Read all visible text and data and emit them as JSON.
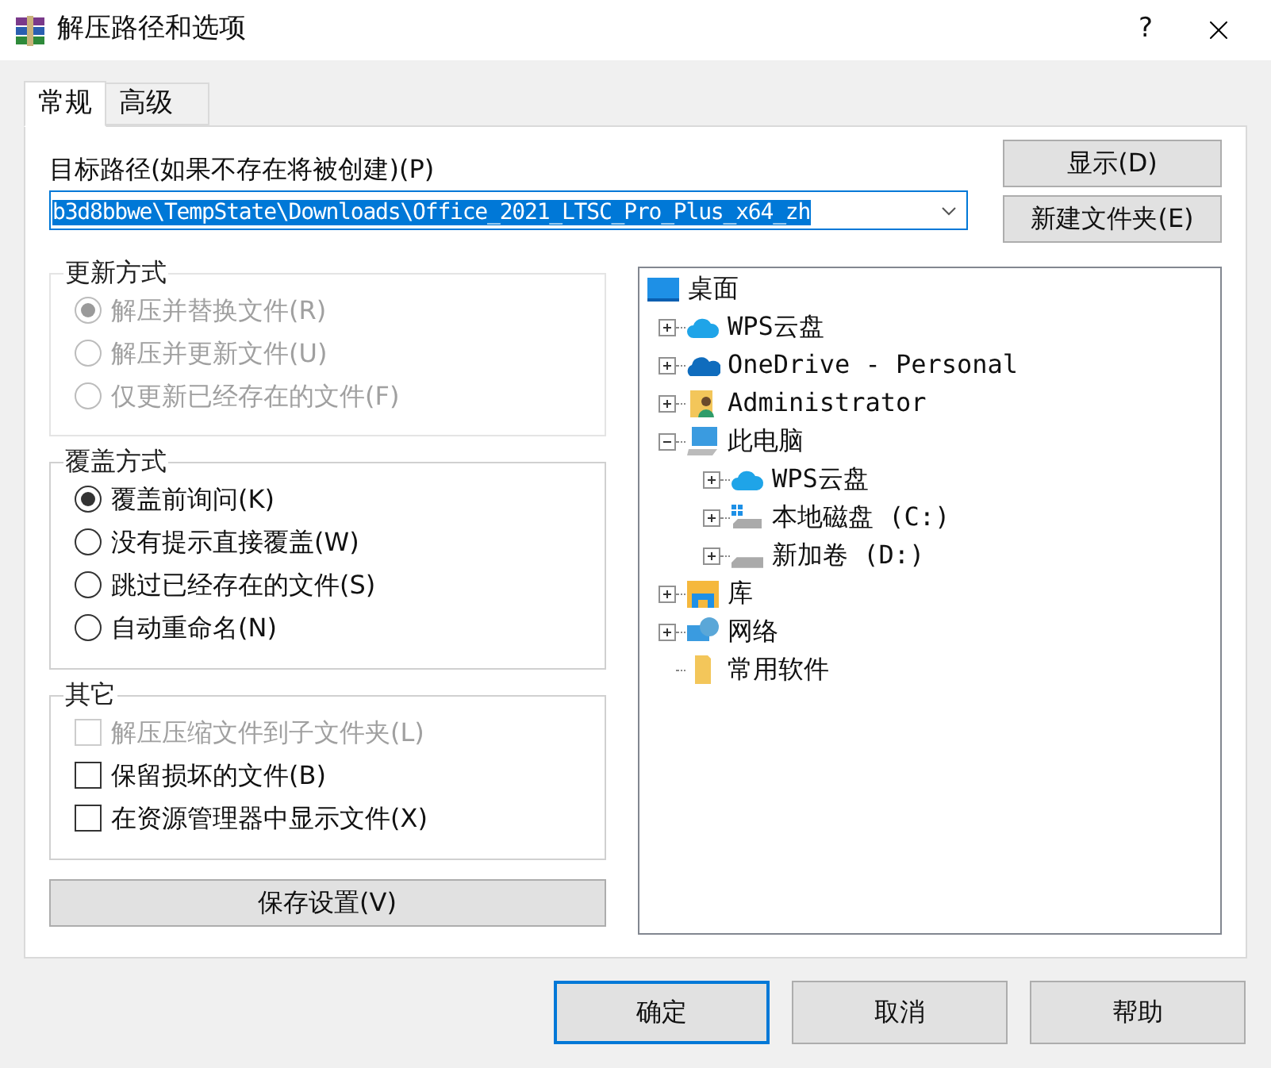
{
  "window": {
    "title": "解压路径和选项",
    "help": "?"
  },
  "tabs": [
    {
      "label": "常规",
      "selected": true
    },
    {
      "label": "高级",
      "selected": false
    }
  ],
  "path": {
    "label": "目标路径(如果不存在将被创建)(P)",
    "value": "b3d8bbwe\\TempState\\Downloads\\Office_2021_LTSC_Pro_Plus_x64_zh"
  },
  "side_buttons": [
    "显示(D)",
    "新建文件夹(E)"
  ],
  "update_mode": {
    "title": "更新方式",
    "disabled": true,
    "options": [
      {
        "label": "解压并替换文件(R)",
        "selected": true
      },
      {
        "label": "解压并更新文件(U)",
        "selected": false
      },
      {
        "label": "仅更新已经存在的文件(F)",
        "selected": false
      }
    ]
  },
  "overwrite_mode": {
    "title": "覆盖方式",
    "disabled": false,
    "options": [
      {
        "label": "覆盖前询问(K)",
        "selected": true
      },
      {
        "label": "没有提示直接覆盖(W)",
        "selected": false
      },
      {
        "label": "跳过已经存在的文件(S)",
        "selected": false
      },
      {
        "label": "自动重命名(N)",
        "selected": false
      }
    ]
  },
  "other": {
    "title": "其它",
    "options": [
      {
        "label": "解压压缩文件到子文件夹(L)",
        "checked": false,
        "disabled": true
      },
      {
        "label": "保留损坏的文件(B)",
        "checked": false,
        "disabled": false
      },
      {
        "label": "在资源管理器中显示文件(X)",
        "checked": false,
        "disabled": false
      }
    ]
  },
  "save_button": "保存设置(V)",
  "tree": [
    {
      "label": "桌面",
      "kind": "desktop",
      "expanded": true,
      "children": [
        {
          "label": "WPS云盘",
          "kind": "cloud",
          "expanded": false
        },
        {
          "label": "OneDrive - Personal",
          "kind": "onedrive",
          "expanded": false
        },
        {
          "label": "Administrator",
          "kind": "user",
          "expanded": false
        },
        {
          "label": "此电脑",
          "kind": "pc",
          "expanded": true,
          "children": [
            {
              "label": "WPS云盘",
              "kind": "cloud",
              "expanded": false
            },
            {
              "label": "本地磁盘 (C:)",
              "kind": "system-drive",
              "expanded": false
            },
            {
              "label": "新加卷 (D:)",
              "kind": "drive",
              "expanded": false
            }
          ]
        },
        {
          "label": "库",
          "kind": "library",
          "expanded": false
        },
        {
          "label": "网络",
          "kind": "network",
          "expanded": false
        },
        {
          "label": "常用软件",
          "kind": "folder"
        }
      ]
    }
  ],
  "footer_buttons": [
    {
      "label": "确定",
      "default": true
    },
    {
      "label": "取消",
      "default": false
    },
    {
      "label": "帮助",
      "default": false
    }
  ]
}
